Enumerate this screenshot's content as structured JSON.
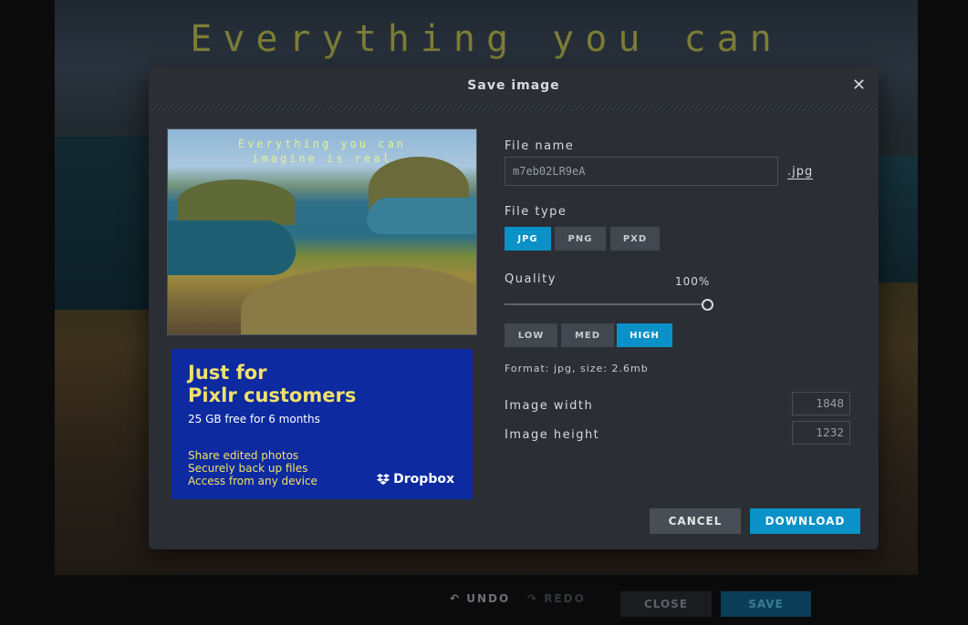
{
  "canvas": {
    "overlay_text": "Everything you can"
  },
  "bottom_bar": {
    "undo": "UNDO",
    "redo": "REDO",
    "close": "CLOSE",
    "save": "SAVE"
  },
  "dialog": {
    "title": "Save image",
    "close_glyph": "✕",
    "preview": {
      "line1": "Everything you can",
      "line2": "imagine is real"
    },
    "ad": {
      "headline_line1": "Just for",
      "headline_line2": "Pixlr customers",
      "subtitle": "25 GB free for 6 months",
      "features": [
        "Share edited photos",
        "Securely back up files",
        "Access from any device"
      ],
      "brand": "Dropbox"
    },
    "file_name": {
      "label": "File name",
      "value": "m7eb02LR9eA",
      "extension": ".jpg"
    },
    "file_type": {
      "label": "File type",
      "options": [
        "JPG",
        "PNG",
        "PXD"
      ],
      "selected": "JPG"
    },
    "quality": {
      "label": "Quality",
      "value_text": "100%",
      "value": 1.0,
      "presets": [
        "LOW",
        "MED",
        "HIGH"
      ],
      "selected": "HIGH"
    },
    "format_info": "Format: jpg, size: 2.6mb",
    "image_width": {
      "label": "Image width",
      "value": "1848"
    },
    "image_height": {
      "label": "Image height",
      "value": "1232"
    },
    "buttons": {
      "cancel": "CANCEL",
      "download": "DOWNLOAD"
    }
  },
  "colors": {
    "accent": "#0a91c8",
    "dialog_bg": "#2b2e34",
    "ad_bg": "#0d2aa0",
    "ad_text": "#f2e06a"
  }
}
